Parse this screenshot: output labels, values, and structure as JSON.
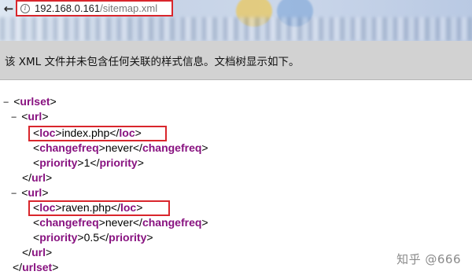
{
  "browser": {
    "back_glyph": "←",
    "url_host": "192.168.0.161",
    "url_path": "/sitemap.xml",
    "info_icon": "i"
  },
  "banner": {
    "text": "该 XML 文件并未包含任何关联的样式信息。文档树显示如下。"
  },
  "xml": {
    "root_tag": "urlset",
    "toggle": "−",
    "url_tag": "url",
    "entries": [
      {
        "loc_tag": "loc",
        "loc": "index.php",
        "changefreq_tag": "changefreq",
        "changefreq": "never",
        "priority_tag": "priority",
        "priority": "1"
      },
      {
        "loc_tag": "loc",
        "loc": "raven.php",
        "changefreq_tag": "changefreq",
        "changefreq": "never",
        "priority_tag": "priority",
        "priority": "0.5"
      }
    ]
  },
  "watermark": "知乎 @666",
  "colors": {
    "highlight": "#d9262c",
    "tag": "#881280",
    "banner_bg": "#d2d2d2"
  }
}
